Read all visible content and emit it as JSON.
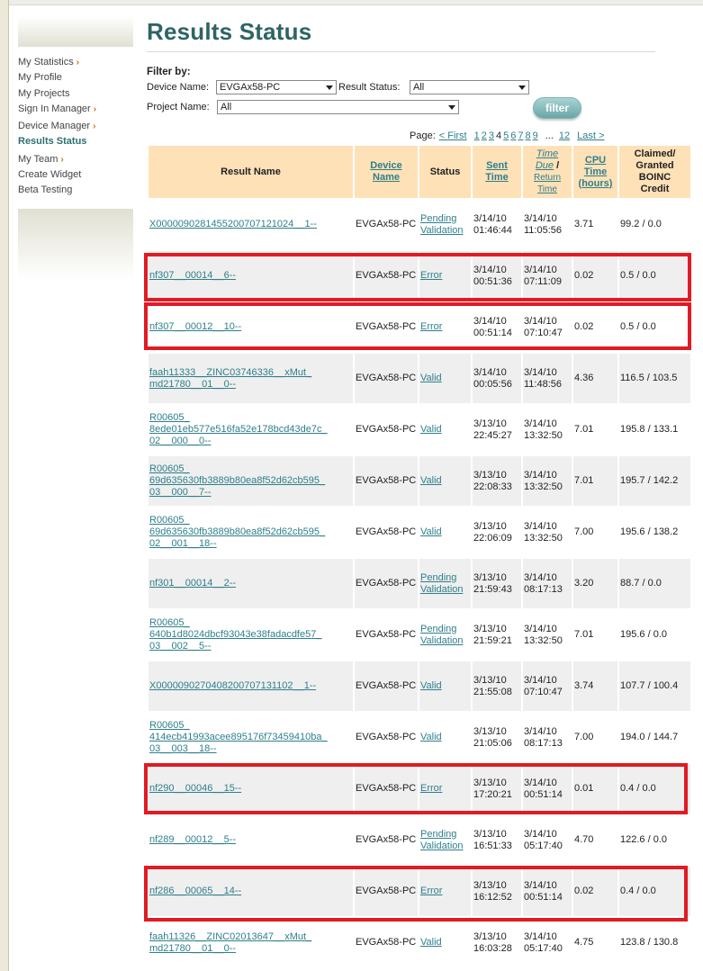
{
  "nav": {
    "items": [
      {
        "label": "My Statistics",
        "arrow": true,
        "active": false,
        "gap": false
      },
      {
        "label": "My Profile",
        "arrow": false,
        "active": false,
        "gap": false
      },
      {
        "label": "My Projects",
        "arrow": false,
        "active": false,
        "gap": false
      },
      {
        "label": "Sign In Manager",
        "arrow": true,
        "active": false,
        "gap": false
      },
      {
        "label": "Device Manager",
        "arrow": true,
        "active": false,
        "gap": true
      },
      {
        "label": "Results Status",
        "arrow": false,
        "active": true,
        "gap": false
      },
      {
        "label": "My Team",
        "arrow": true,
        "active": false,
        "gap": true
      },
      {
        "label": "Create Widget",
        "arrow": false,
        "active": false,
        "gap": false
      },
      {
        "label": "Beta Testing",
        "arrow": false,
        "active": false,
        "gap": false
      }
    ],
    "arrow_glyph": "›"
  },
  "page": {
    "title": "Results Status"
  },
  "filter": {
    "heading": "Filter by:",
    "device_label": "Device Name:",
    "device_value": "EVGAx58-PC",
    "status_label": "Result Status:",
    "status_value": "All",
    "project_label": "Project Name:",
    "project_value": "All",
    "button_label": "filter"
  },
  "pager": {
    "label": "Page:",
    "first": "< First",
    "pages": [
      "1",
      "2",
      "3",
      "4",
      "5",
      "6",
      "7",
      "8",
      "9"
    ],
    "current": "4",
    "ellipsis": "...",
    "last_page": "12",
    "last": "Last >"
  },
  "table": {
    "headers": {
      "result_name": "Result Name",
      "device_name": [
        "Device",
        "Name"
      ],
      "status": "Status",
      "sent_time": [
        "Sent",
        "Time"
      ],
      "time_due": [
        "Time",
        "Due"
      ],
      "time_slash": "/",
      "return_time": [
        "Return",
        "Time"
      ],
      "cpu_time": [
        "CPU",
        "Time",
        "(hours)"
      ],
      "credit": [
        "Claimed/",
        "Granted",
        "BOINC",
        "Credit"
      ]
    },
    "rows": [
      {
        "name": [
          "X0000090281455200707121024__1--"
        ],
        "device": "EVGAx58-PC",
        "status": [
          "Pending",
          "Validation"
        ],
        "sent": [
          "3/14/10",
          "01:46:44"
        ],
        "due": [
          "3/14/10",
          "11:05:56"
        ],
        "cpu": "3.71",
        "credit": "99.2 / 0.0"
      },
      {
        "name": [
          "nf307__00014__6--"
        ],
        "device": "EVGAx58-PC",
        "status": [
          "Error"
        ],
        "sent": [
          "3/14/10",
          "00:51:36"
        ],
        "due": [
          "3/14/10",
          "07:11:09"
        ],
        "cpu": "0.02",
        "credit": "0.5 / 0.0"
      },
      {
        "name": [
          "nf307__00012__10--"
        ],
        "device": "EVGAx58-PC",
        "status": [
          "Error"
        ],
        "sent": [
          "3/14/10",
          "00:51:14"
        ],
        "due": [
          "3/14/10",
          "07:10:47"
        ],
        "cpu": "0.02",
        "credit": "0.5 / 0.0"
      },
      {
        "name": [
          "faah11333__ZINC03746336__xMut_",
          "md21780__01__0--"
        ],
        "device": "EVGAx58-PC",
        "status": [
          "Valid"
        ],
        "sent": [
          "3/14/10",
          "00:05:56"
        ],
        "due": [
          "3/14/10",
          "11:48:56"
        ],
        "cpu": "4.36",
        "credit": "116.5 / 103.5"
      },
      {
        "name": [
          "R00605_",
          "8ede01eb577e516fa52e178bcd43de7c_",
          "02__000__0--"
        ],
        "device": "EVGAx58-PC",
        "status": [
          "Valid"
        ],
        "sent": [
          "3/13/10",
          "22:45:27"
        ],
        "due": [
          "3/14/10",
          "13:32:50"
        ],
        "cpu": "7.01",
        "credit": "195.8 / 133.1"
      },
      {
        "name": [
          "R00605_",
          "69d635630fb3889b80ea8f52d62cb595_",
          "03__000__7--"
        ],
        "device": "EVGAx58-PC",
        "status": [
          "Valid"
        ],
        "sent": [
          "3/13/10",
          "22:08:33"
        ],
        "due": [
          "3/14/10",
          "13:32:50"
        ],
        "cpu": "7.01",
        "credit": "195.7 / 142.2"
      },
      {
        "name": [
          "R00605_",
          "69d635630fb3889b80ea8f52d62cb595_",
          "02__001__18--"
        ],
        "device": "EVGAx58-PC",
        "status": [
          "Valid"
        ],
        "sent": [
          "3/13/10",
          "22:06:09"
        ],
        "due": [
          "3/14/10",
          "13:32:50"
        ],
        "cpu": "7.00",
        "credit": "195.6 / 138.2"
      },
      {
        "name": [
          "nf301__00014__2--"
        ],
        "device": "EVGAx58-PC",
        "status": [
          "Pending",
          "Validation"
        ],
        "sent": [
          "3/13/10",
          "21:59:43"
        ],
        "due": [
          "3/14/10",
          "08:17:13"
        ],
        "cpu": "3.20",
        "credit": "88.7 / 0.0"
      },
      {
        "name": [
          "R00605_",
          "640b1d8024dbcf93043e38fadacdfe57_",
          "03__002__5--"
        ],
        "device": "EVGAx58-PC",
        "status": [
          "Pending",
          "Validation"
        ],
        "sent": [
          "3/13/10",
          "21:59:21"
        ],
        "due": [
          "3/14/10",
          "13:32:50"
        ],
        "cpu": "7.01",
        "credit": "195.6 / 0.0"
      },
      {
        "name": [
          "X0000090270408200707131102__1--"
        ],
        "device": "EVGAx58-PC",
        "status": [
          "Valid"
        ],
        "sent": [
          "3/13/10",
          "21:55:08"
        ],
        "due": [
          "3/14/10",
          "07:10:47"
        ],
        "cpu": "3.74",
        "credit": "107.7 / 100.4"
      },
      {
        "name": [
          "R00605_",
          "414ecb41993acee895176f73459410ba_",
          "03__003__18--"
        ],
        "device": "EVGAx58-PC",
        "status": [
          "Valid"
        ],
        "sent": [
          "3/13/10",
          "21:05:06"
        ],
        "due": [
          "3/14/10",
          "08:17:13"
        ],
        "cpu": "7.00",
        "credit": "194.0 / 144.7"
      },
      {
        "name": [
          "nf290__00046__15--"
        ],
        "device": "EVGAx58-PC",
        "status": [
          "Error"
        ],
        "sent": [
          "3/13/10",
          "17:20:21"
        ],
        "due": [
          "3/14/10",
          "00:51:14"
        ],
        "cpu": "0.01",
        "credit": "0.4 / 0.0"
      },
      {
        "name": [
          "nf289__00012__5--"
        ],
        "device": "EVGAx58-PC",
        "status": [
          "Pending",
          "Validation"
        ],
        "sent": [
          "3/13/10",
          "16:51:33"
        ],
        "due": [
          "3/14/10",
          "05:17:40"
        ],
        "cpu": "4.70",
        "credit": "122.6 / 0.0"
      },
      {
        "name": [
          "nf286__00065__14--"
        ],
        "device": "EVGAx58-PC",
        "status": [
          "Error"
        ],
        "sent": [
          "3/13/10",
          "16:12:52"
        ],
        "due": [
          "3/14/10",
          "00:51:14"
        ],
        "cpu": "0.02",
        "credit": "0.4 / 0.0"
      },
      {
        "name": [
          "faah11326__ZINC02013647__xMut_",
          "md21780__01__0--"
        ],
        "device": "EVGAx58-PC",
        "status": [
          "Valid"
        ],
        "sent": [
          "3/13/10",
          "16:03:28"
        ],
        "due": [
          "3/14/10",
          "05:17:40"
        ],
        "cpu": "4.75",
        "credit": "123.8 / 130.8"
      }
    ]
  },
  "colors": {
    "title": "#2e6464",
    "link": "#2e7f8a",
    "header_bg": "#ffe1b8",
    "row_alt": "#efefef",
    "highlight": "#e01b24"
  }
}
